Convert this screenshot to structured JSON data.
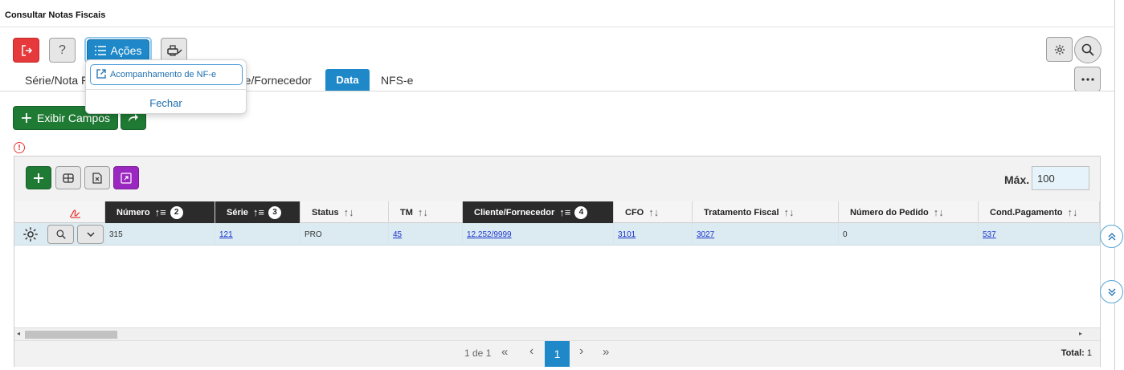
{
  "window": {
    "title": "Consultar Notas Fiscais"
  },
  "toolbar": {
    "acoes_label": "Ações",
    "help_label": "?"
  },
  "dropdown": {
    "item_monitor": "Acompanhamento de NF-e",
    "item_close": "Fechar"
  },
  "tabs": [
    {
      "label": "Série/Nota Fi"
    },
    {
      "label": "nte/Fornecedor"
    },
    {
      "label": "Data",
      "active": true
    },
    {
      "label": "NFS-e"
    }
  ],
  "actions": {
    "exibir_campos": "Exibir Campos"
  },
  "grid": {
    "max_label": "Máx.",
    "max_value": "100",
    "columns": [
      {
        "label": "Número",
        "sort_order": "2"
      },
      {
        "label": "Série",
        "sort_order": "3"
      },
      {
        "label": "Status"
      },
      {
        "label": "TM"
      },
      {
        "label": "Cliente/Fornecedor",
        "sort_order": "4"
      },
      {
        "label": "CFO"
      },
      {
        "label": "Tratamento Fiscal"
      },
      {
        "label": "Número do Pedido"
      },
      {
        "label": "Cond.Pagamento"
      }
    ],
    "rows": [
      {
        "numero": "315",
        "serie": "121",
        "status": "PRO",
        "tm": "45",
        "cliente": "12.252/9999",
        "cfo": "3101",
        "tratamento": "3027",
        "pedido": "0",
        "cond_pagamento": "537"
      }
    ]
  },
  "pager": {
    "info": "1 de 1",
    "first": "«",
    "prev": "‹",
    "current": "1",
    "next": "›",
    "last": "»",
    "total_label": "Total:",
    "total_value": "1"
  },
  "colors": {
    "accent": "#1e88c9",
    "danger": "#e5393b",
    "success": "#1f7a33",
    "purple": "#9b27c1",
    "row_selected": "#dcebf1",
    "sorted_header": "#2b2b2b"
  },
  "icons": [
    "exit-icon",
    "help-icon",
    "list-icon",
    "print-icon",
    "gear-icon",
    "search-icon",
    "more-icon",
    "plus-icon",
    "share-icon",
    "info-icon",
    "columns-icon",
    "excel-icon",
    "expand-icon",
    "signature-icon",
    "chevron-down-icon",
    "scroll-up-icon",
    "scroll-down-icon",
    "external-link-icon"
  ]
}
